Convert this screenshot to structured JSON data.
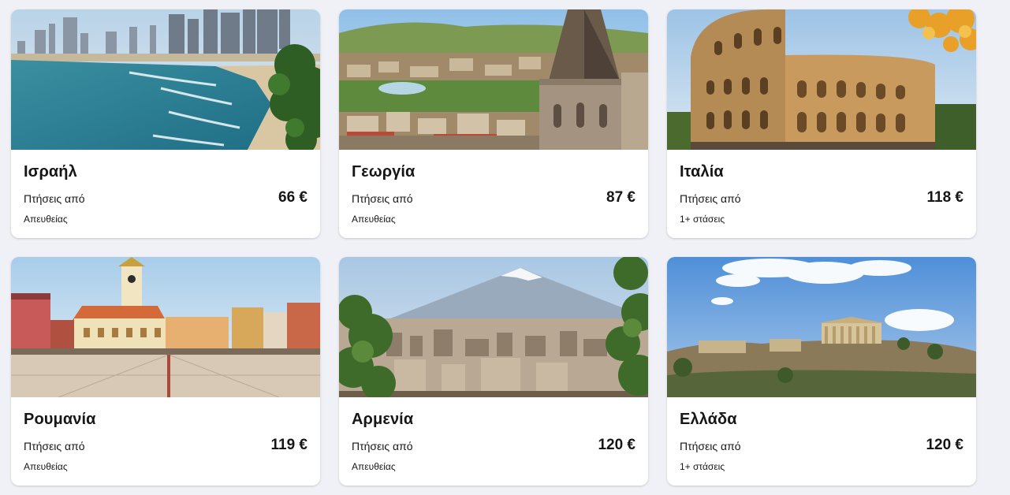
{
  "destinations": [
    {
      "name": "Ισραήλ",
      "label": "Πτήσεις από",
      "price": "66 €",
      "stops": "Απευθείας",
      "image": "tel-aviv-beach-photo"
    },
    {
      "name": "Γεωργία",
      "label": "Πτήσεις από",
      "price": "87 €",
      "stops": "Απευθείας",
      "image": "tbilisi-church-photo"
    },
    {
      "name": "Ιταλία",
      "label": "Πτήσεις από",
      "price": "118 €",
      "stops": "1+ στάσεις",
      "image": "rome-colosseum-photo"
    },
    {
      "name": "Ρουμανία",
      "label": "Πτήσεις από",
      "price": "119 €",
      "stops": "Απευθείας",
      "image": "brasov-square-photo"
    },
    {
      "name": "Αρμενία",
      "label": "Πτήσεις από",
      "price": "120 €",
      "stops": "Απευθείας",
      "image": "yerevan-ararat-photo"
    },
    {
      "name": "Ελλάδα",
      "label": "Πτήσεις από",
      "price": "120 €",
      "stops": "1+ στάσεις",
      "image": "athens-acropolis-photo"
    }
  ]
}
